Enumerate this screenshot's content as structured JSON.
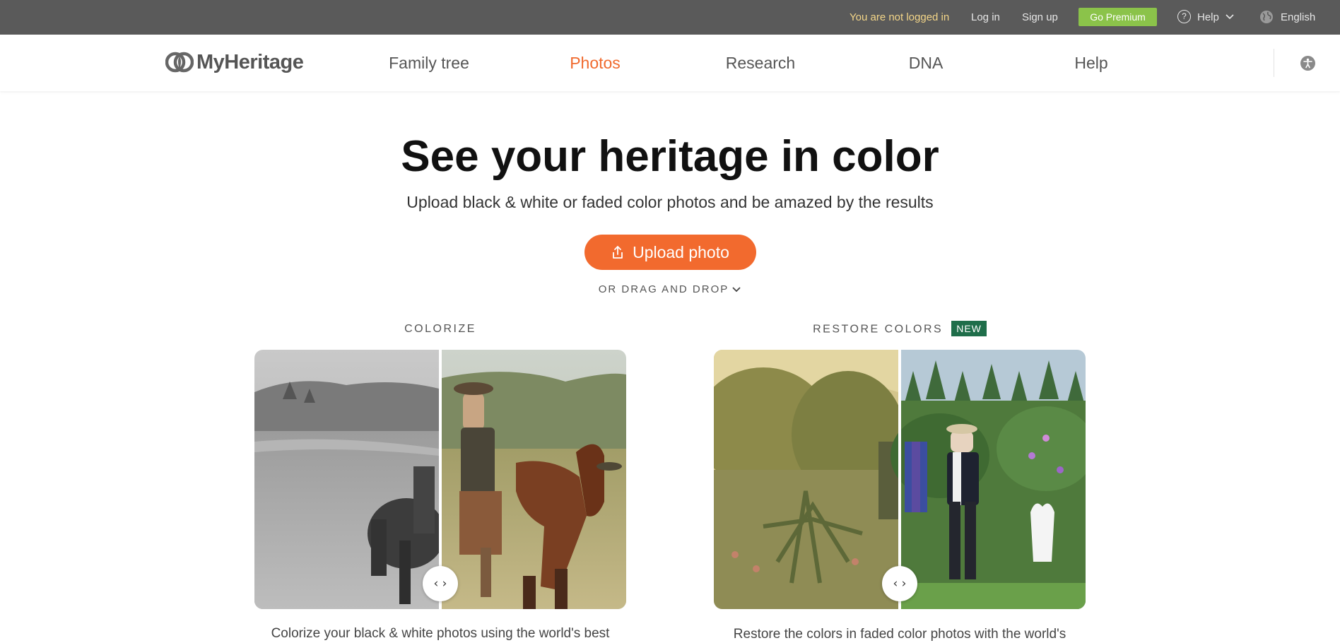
{
  "topbar": {
    "not_logged_in": "You are not logged in",
    "log_in": "Log in",
    "sign_up": "Sign up",
    "go_premium": "Go Premium",
    "help": "Help",
    "language": "English",
    "help_icon_glyph": "?"
  },
  "nav": {
    "logo_text": "MyHeritage",
    "items": [
      "Family tree",
      "Photos",
      "Research",
      "DNA",
      "Help"
    ],
    "active": "Photos"
  },
  "hero": {
    "title": "See your heritage in color",
    "subtitle": "Upload black & white or faded color photos and be amazed by the results",
    "upload_label": "Upload photo",
    "drag_drop": "OR DRAG AND DROP"
  },
  "features": {
    "colorize": {
      "label": "COLORIZE",
      "caption": "Colorize your black & white photos using the world's best",
      "handle_glyph": "‹ ›"
    },
    "restore": {
      "label": "RESTORE COLORS",
      "badge": "NEW",
      "caption": "Restore the colors in faded color photos with the world's",
      "handle_glyph": "‹ ›"
    }
  },
  "colors": {
    "topbar_bg": "#5a5a5a",
    "accent_orange": "#f26a2e",
    "premium_green": "#8bc34a",
    "badge_green": "#1f6e4a",
    "not_logged_yellow": "#f3d588"
  },
  "icons": [
    "help-circle-icon",
    "chevron-down-icon",
    "globe-icon",
    "myheritage-logo-icon",
    "accessibility-icon",
    "upload-icon",
    "slider-arrows-icon"
  ]
}
